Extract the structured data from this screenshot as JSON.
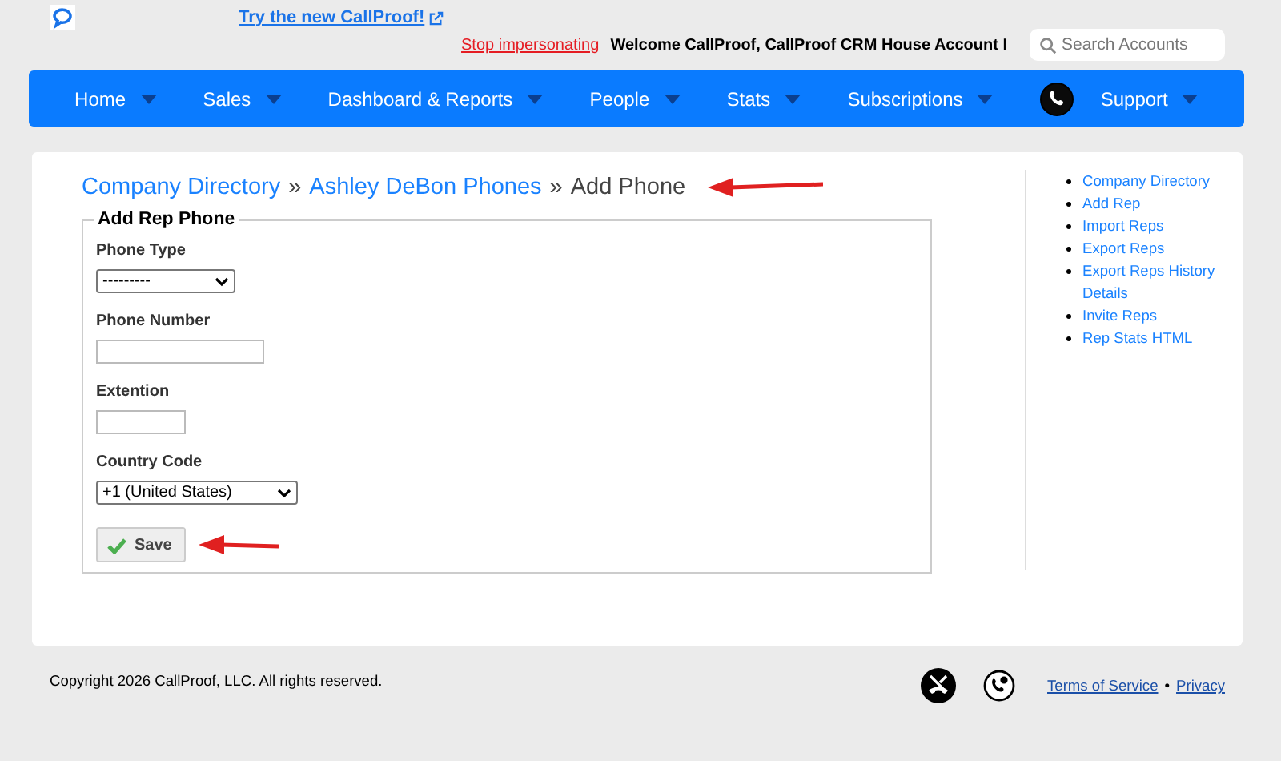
{
  "header": {
    "promo_link": "Try the new CallProof!",
    "stop_link": "Stop impersonating",
    "welcome": "Welcome CallProof, CallProof CRM House Account I",
    "search": {
      "placeholder": "Search Accounts"
    }
  },
  "nav": [
    {
      "label": "Home"
    },
    {
      "label": "Sales"
    },
    {
      "label": "Dashboard & Reports"
    },
    {
      "label": "People"
    },
    {
      "label": "Stats"
    },
    {
      "label": "Subscriptions"
    },
    {
      "label": "Support",
      "phone_icon": true
    }
  ],
  "breadcrumb": [
    {
      "label": "Company Directory",
      "link": true
    },
    {
      "label": "Ashley DeBon Phones",
      "link": true
    },
    {
      "label": "Add Phone",
      "link": false
    }
  ],
  "breadcrumb_separator": "»",
  "form": {
    "legend": "Add Rep Phone",
    "fields": [
      {
        "kind": "select",
        "label": "Phone Type",
        "value": "---------"
      },
      {
        "kind": "text",
        "label": "Phone Number"
      },
      {
        "kind": "text",
        "label": "Extention"
      },
      {
        "kind": "select",
        "label": "Country Code",
        "value": "+1 (United States)"
      }
    ],
    "save_button": "Save"
  },
  "sidebar": {
    "items": [
      {
        "label": "Company Directory"
      },
      {
        "label": "Add Rep"
      },
      {
        "label": "Import Reps"
      },
      {
        "label": "Export Reps"
      },
      {
        "label": "Export Reps History Details"
      },
      {
        "label": "Invite Reps"
      },
      {
        "label": "Rep Stats HTML"
      }
    ]
  },
  "footer": {
    "copyright": "Copyright 2026 CallProof, LLC. All rights reserved.",
    "links": [
      {
        "label": "Terms of Service"
      },
      {
        "label": "Privacy"
      }
    ],
    "separator": "•"
  }
}
